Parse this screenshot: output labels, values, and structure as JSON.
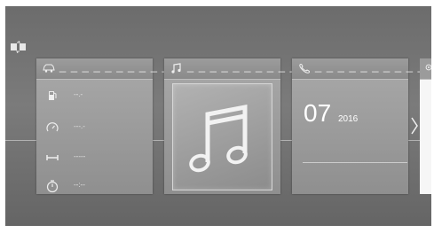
{
  "header": {
    "swap_icon": "display-swap-icon"
  },
  "cards": {
    "vehicle": {
      "header_icon": "car-icon",
      "header_dashes": "_ _ _ _ _ _ _ _ _ _",
      "rows": [
        {
          "icon": "fuel-icon",
          "value": "--.-"
        },
        {
          "icon": "speedometer-icon",
          "value": "---.-"
        },
        {
          "icon": "distance-icon",
          "value": "-----"
        },
        {
          "icon": "timer-icon",
          "value": "--:--"
        }
      ]
    },
    "media": {
      "header_icon": "music-note-icon",
      "header_dashes": "_ _ _ _ _ _ _ _ _ _",
      "artwork_icon": "music-note-icon"
    },
    "phone": {
      "header_icon": "phone-icon",
      "header_dashes": "_ _ _ _ _ _ _ _ _ _",
      "day": "07",
      "year": "2016"
    },
    "next": {
      "header_icon": "settings-icon"
    }
  },
  "navigation": {
    "next_icon": "chevron-right-icon"
  }
}
